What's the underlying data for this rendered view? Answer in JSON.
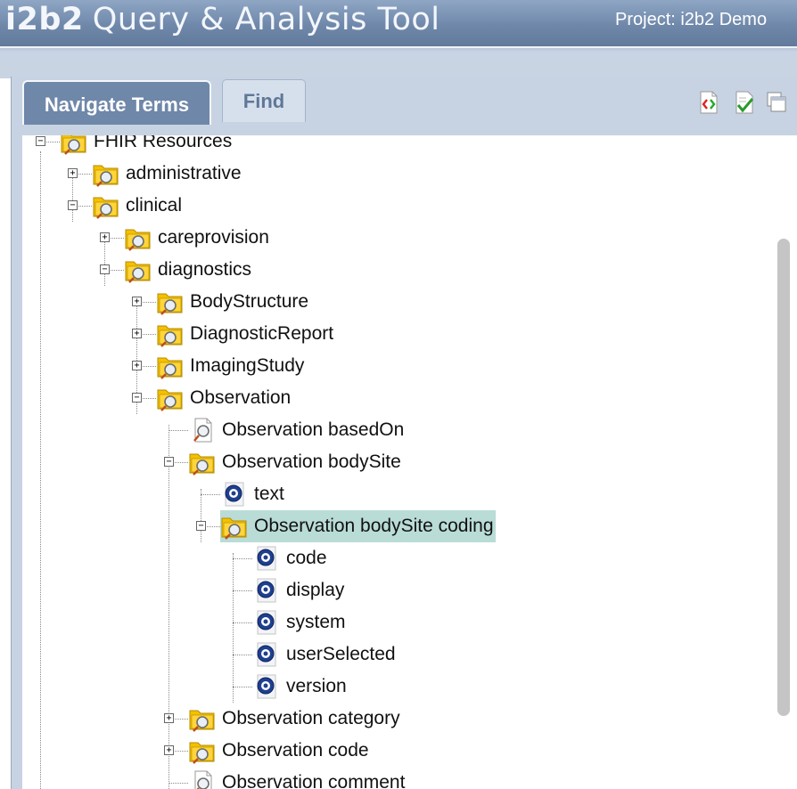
{
  "header": {
    "logo": "i2b2",
    "title": "Query & Analysis Tool",
    "project": "Project: i2b2 Demo"
  },
  "tabs": [
    {
      "label": "Navigate Terms",
      "active": true
    },
    {
      "label": "Find",
      "active": false
    }
  ],
  "toolbar": {
    "icons": [
      "show-codes-icon",
      "show-counts-icon",
      "show-windows-icon"
    ]
  },
  "tree": {
    "nodes": [
      {
        "label": "FHIR Resources",
        "level": 0,
        "type": "folder",
        "expanded": true
      },
      {
        "label": "administrative",
        "level": 1,
        "type": "folder",
        "expanded": false
      },
      {
        "label": "clinical",
        "level": 1,
        "type": "folder",
        "expanded": true
      },
      {
        "label": "careprovision",
        "level": 2,
        "type": "folder",
        "expanded": false
      },
      {
        "label": "diagnostics",
        "level": 2,
        "type": "folder",
        "expanded": true
      },
      {
        "label": "BodyStructure",
        "level": 3,
        "type": "folder",
        "expanded": false
      },
      {
        "label": "DiagnosticReport",
        "level": 3,
        "type": "folder",
        "expanded": false
      },
      {
        "label": "ImagingStudy",
        "level": 3,
        "type": "folder",
        "expanded": false
      },
      {
        "label": "Observation",
        "level": 3,
        "type": "folder",
        "expanded": true
      },
      {
        "label": "Observation basedOn",
        "level": 4,
        "type": "document"
      },
      {
        "label": "Observation bodySite",
        "level": 4,
        "type": "folder",
        "expanded": true
      },
      {
        "label": "text",
        "level": 5,
        "type": "leaf"
      },
      {
        "label": "Observation bodySite coding",
        "level": 5,
        "type": "folder",
        "expanded": true,
        "selected": true
      },
      {
        "label": "code",
        "level": 6,
        "type": "leaf"
      },
      {
        "label": "display",
        "level": 6,
        "type": "leaf"
      },
      {
        "label": "system",
        "level": 6,
        "type": "leaf"
      },
      {
        "label": "userSelected",
        "level": 6,
        "type": "leaf"
      },
      {
        "label": "version",
        "level": 6,
        "type": "leaf"
      },
      {
        "label": "Observation category",
        "level": 4,
        "type": "folder",
        "expanded": false
      },
      {
        "label": "Observation code",
        "level": 4,
        "type": "folder",
        "expanded": false
      },
      {
        "label": "Observation comment",
        "level": 4,
        "type": "document"
      }
    ]
  },
  "colors": {
    "header": "#6f88aa",
    "panel": "#c7d3e2",
    "selected": "#b9dcd6",
    "folder": "#f5c400"
  }
}
